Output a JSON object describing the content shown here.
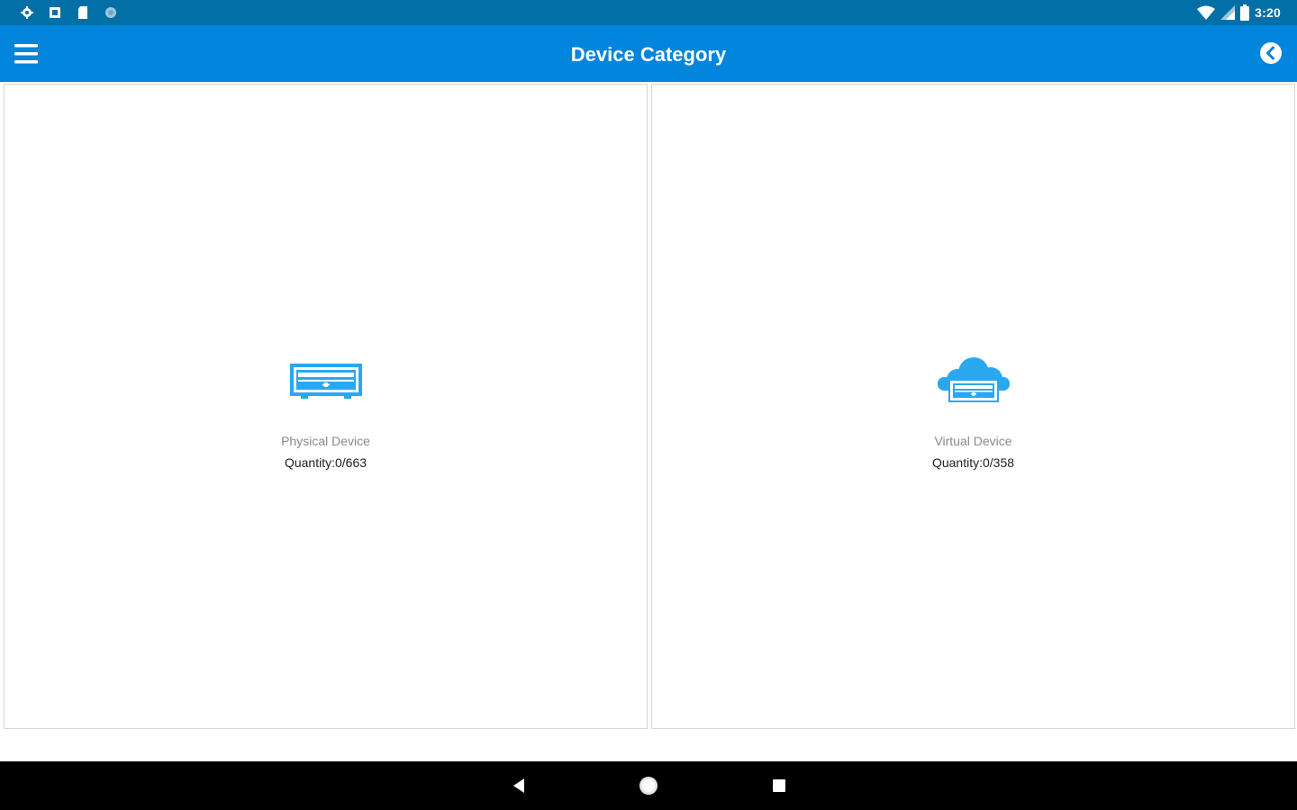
{
  "status_bar": {
    "time": "3:20",
    "left_icons": [
      "settings-icon",
      "notification-icon",
      "sd-card-icon",
      "sync-icon"
    ],
    "right_icons": [
      "wifi-icon",
      "signal-icon",
      "battery-icon"
    ]
  },
  "app_bar": {
    "title": "Device Category",
    "menu_icon": "hamburger-menu-icon",
    "back_icon": "back-circle-icon"
  },
  "categories": [
    {
      "label": "Physical Device",
      "quantity": "Quantity:0/663",
      "icon": "physical-device-icon"
    },
    {
      "label": "Virtual Device",
      "quantity": "Quantity:0/358",
      "icon": "virtual-device-icon"
    }
  ],
  "nav_bar": {
    "icons": [
      "nav-back-icon",
      "nav-home-icon",
      "nav-recents-icon"
    ]
  },
  "colors": {
    "status_bar": "#0270a6",
    "app_bar": "#0285dc",
    "icon_accent": "#29a8f0",
    "nav_bar": "#000000"
  }
}
